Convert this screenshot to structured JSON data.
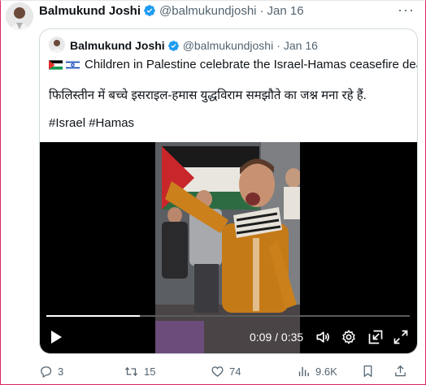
{
  "tweet": {
    "author_name": "Balmukund Joshi",
    "handle": "@balmukundjoshi",
    "separator": "·",
    "date": "Jan 16",
    "more_label": "···"
  },
  "quoted": {
    "author_name": "Balmukund Joshi",
    "handle": "@balmukundjoshi",
    "separator": "·",
    "date": "Jan 16",
    "text_en": "Children in Palestine celebrate the Israel-Hamas ceasefire deal.",
    "text_hi": "फिलिस्तीन में बच्चे इसराइल-हमास युद्धविराम समझौते का जश्न मना रहे हैं.",
    "hashtags": "#Israel #Hamas",
    "flags": [
      "palestine-flag",
      "israel-flag"
    ]
  },
  "video": {
    "time_display": "0:09 / 0:35",
    "progress": 0.257,
    "controls": [
      "play-icon",
      "volume-icon",
      "settings-icon",
      "pip-icon",
      "fullscreen-icon"
    ]
  },
  "actions": {
    "replies": "3",
    "reposts": "15",
    "likes": "74",
    "views": "9.6K"
  },
  "colors": {
    "verified": "#1d9bf0",
    "text_secondary": "#536471",
    "border": "#cfd9de"
  }
}
